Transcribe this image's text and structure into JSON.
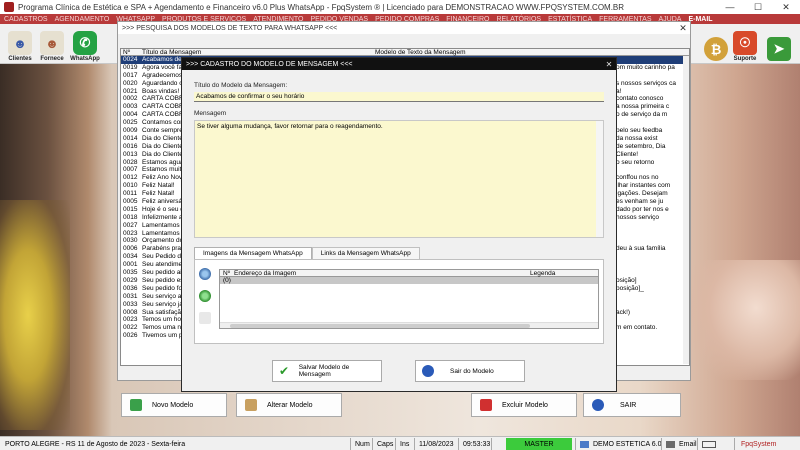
{
  "window": {
    "title": "Programa Clínica de Estética e SPA + Agendamento e Financeiro v6.0 Plus WhatsApp - FpqSystem ® | Licenciado para  DEMONSTRACAO WWW.FPQSYSTEM.COM.BR",
    "minimize": "—",
    "maximize": "☐",
    "close": "✕"
  },
  "menu": [
    "CADASTROS",
    "AGENDAMENTO",
    "WHATSAPP",
    "PRODUTOS E SERVIÇOS",
    "ATENDIMENTO",
    "PEDIDO VENDAS",
    "PEDIDO COMPRAS",
    "FINANCEIRO",
    "RELATÓRIOS",
    "ESTATÍSTICA",
    "FERRAMENTAS",
    "AJUDA",
    "E-MAIL"
  ],
  "toolbar": {
    "clientes": "Clientes",
    "fornece": "Fornece",
    "whatsapp": "WhatsApp",
    "suporte": "Suporte"
  },
  "search_window": {
    "title": ">>> PESQUISA DOS MODELOS DE TEXTO PARA WHATSAPP <<<",
    "close": "✕",
    "columns": {
      "num": "Nº",
      "titulo": "Título da Mensagem",
      "texto": "Modelo de Texto da Mensagem"
    },
    "rows": [
      {
        "id": "0024",
        "title": "Acabamos de c",
        "text": "",
        "selected": true
      },
      {
        "id": "0019",
        "title": "Agora você faz",
        "text": "om muito carinho pa"
      },
      {
        "id": "0017",
        "title": "Agradecemos",
        "text": ""
      },
      {
        "id": "0020",
        "title": "Aguardando o s",
        "text": "s nossos serviços ca"
      },
      {
        "id": "0021",
        "title": "Boas vindas!",
        "text": "a!"
      },
      {
        "id": "0002",
        "title": "CARTA COBRAN",
        "text": "contato conosco"
      },
      {
        "id": "0003",
        "title": "CARTA COBRAN",
        "text": "a nossa primeira c"
      },
      {
        "id": "0004",
        "title": "CARTA COBRAN",
        "text": "o de serviço da m"
      },
      {
        "id": "0025",
        "title": "Contamos com",
        "text": ""
      },
      {
        "id": "0009",
        "title": "Conte sempre c",
        "text": "pelo seu feedba"
      },
      {
        "id": "0014",
        "title": "Dia do Cliente",
        "text": "da nossa exist"
      },
      {
        "id": "0016",
        "title": "Dia do Cliente",
        "text": "de setembro, Dia"
      },
      {
        "id": "0013",
        "title": "Dia do Cliente!",
        "text": "Cliente!"
      },
      {
        "id": "0028",
        "title": "Estamos aguard",
        "text": "o seu retorno"
      },
      {
        "id": "0007",
        "title": "Estamos muito f",
        "text": ""
      },
      {
        "id": "0012",
        "title": "Feliz Ano Novo!",
        "text": "conffou nos no"
      },
      {
        "id": "0010",
        "title": "Feliz Natal!",
        "text": "ilhar instantes com"
      },
      {
        "id": "0011",
        "title": "Feliz Natal!",
        "text": "igações. Desejam"
      },
      {
        "id": "0005",
        "title": "Feliz aniversári",
        "text": "es venham se ju"
      },
      {
        "id": "0015",
        "title": "Hoje é o seu di",
        "text": "dado por ter nos e"
      },
      {
        "id": "0018",
        "title": "Infelizmente ain",
        "text": "nossos serviço"
      },
      {
        "id": "0027",
        "title": "Lamentamos a s",
        "text": ""
      },
      {
        "id": "0023",
        "title": "Lamentamos o c",
        "text": ""
      },
      {
        "id": "0030",
        "title": "Orçamento do s",
        "text": ""
      },
      {
        "id": "0006",
        "title": "Parabéns pra vo",
        "text": "deu à sua família"
      },
      {
        "id": "0034",
        "title": "Seu Pedido de V",
        "text": ""
      },
      {
        "id": "0001",
        "title": "Seu atendiment",
        "text": ""
      },
      {
        "id": "0035",
        "title": "Seu pedido aind",
        "text": ""
      },
      {
        "id": "0029",
        "title": "Seu pedido está",
        "text": "osição]"
      },
      {
        "id": "0036",
        "title": "Seu pedido foi D",
        "text": "posição]_"
      },
      {
        "id": "0031",
        "title": "Seu serviço apr",
        "text": ""
      },
      {
        "id": "0033",
        "title": "Seu serviço já e",
        "text": ""
      },
      {
        "id": "0008",
        "title": "Sua satisfação é",
        "text": "ack!)"
      },
      {
        "id": "0023",
        "title": "Temos um horár",
        "text": ""
      },
      {
        "id": "0022",
        "title": "Temos uma notí",
        "text": "m em contato."
      },
      {
        "id": "0026",
        "title": "Tivemos um pro",
        "text": ""
      }
    ]
  },
  "bottom_buttons": {
    "novo": "Novo Modelo",
    "alterar": "Alterar Modelo",
    "excluir": "Excluir Modelo",
    "sair": "SAIR"
  },
  "modal": {
    "title": ">>> CADASTRO DO MODELO DE MENSAGEM <<<",
    "close": "✕",
    "title_label": "Título do Modelo da Mensagem:",
    "title_value": "Acabamos de confirmar o seu horário",
    "message_label": "Mensagem",
    "message_value": "Se tiver alguma mudança, favor retornar para o reagendamento.",
    "tabs": [
      "Imagens da Mensagem WhatsApp",
      "Links da Mensagem WhatsApp"
    ],
    "image_grid": {
      "col_num": "Nº",
      "col_path": "Endereço da Imagem",
      "col_caption": "Legenda",
      "row_num": "(0)"
    },
    "save_button": "Salvar Modelo de Mensagem",
    "exit_button": "Sair do Modelo"
  },
  "statusbar": {
    "location": "PORTO ALEGRE - RS 11 de Agosto de 2023 - Sexta-feira",
    "num": "Num",
    "caps": "Caps",
    "ins": "Ins",
    "date": "11/08/2023",
    "time": "09:53:33",
    "master": "MASTER",
    "edition": "DEMO ESTETICA 6.0",
    "email": "Email",
    "brand": "FpqSystem"
  },
  "colors": {
    "menubar": "#b83a3a",
    "selected_row": "#1f3e78",
    "input_bg": "#fbf8cf",
    "master_green": "#3ccb3c"
  }
}
